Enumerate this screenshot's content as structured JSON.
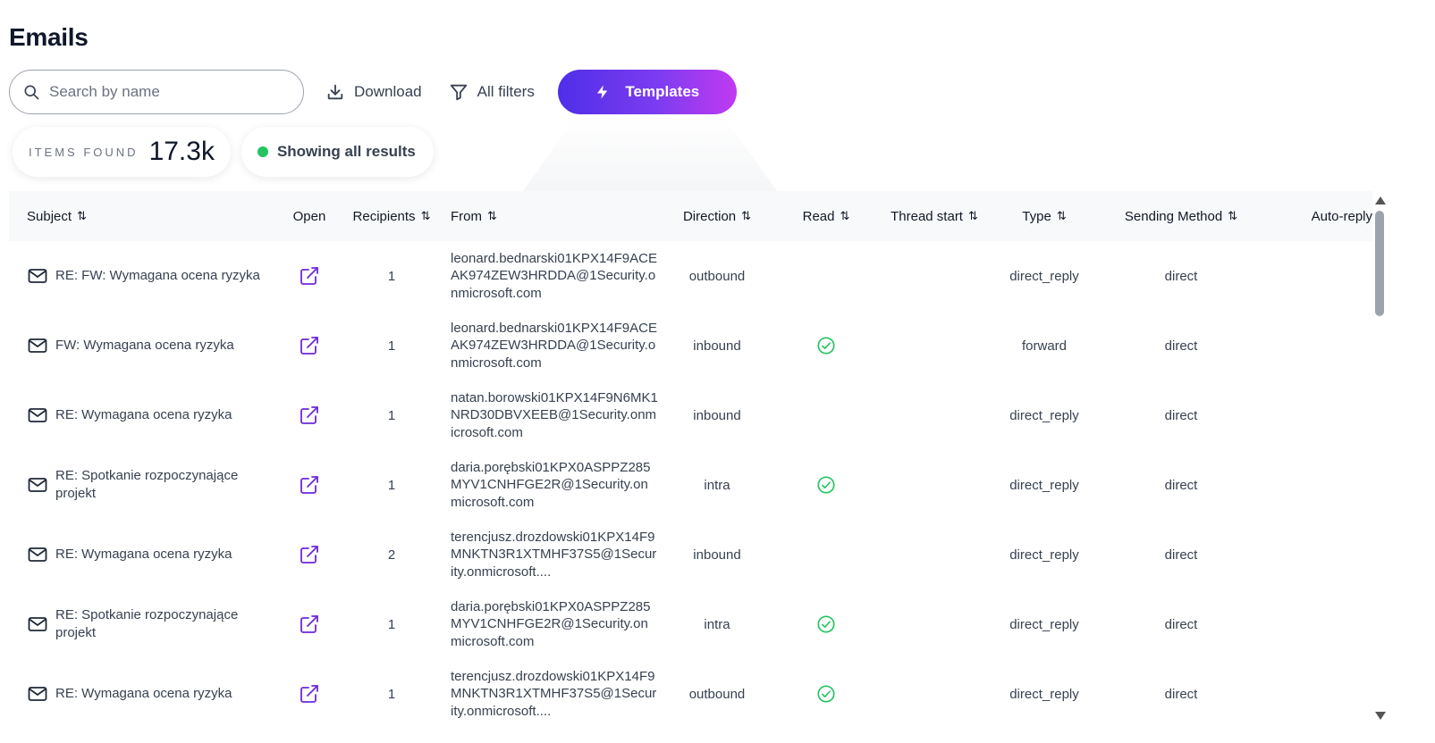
{
  "page": {
    "title": "Emails"
  },
  "toolbar": {
    "search_placeholder": "Search by name",
    "download_label": "Download",
    "filters_label": "All filters",
    "templates_label": "Templates"
  },
  "stats": {
    "items_label": "ITEMS FOUND",
    "items_value": "17.3k",
    "status_text": "Showing all results",
    "status_color": "#22c55e"
  },
  "table": {
    "columns": {
      "subject": "Subject",
      "open": "Open",
      "recipients": "Recipients",
      "from": "From",
      "direction": "Direction",
      "read": "Read",
      "thread_start": "Thread start",
      "type": "Type",
      "sending_method": "Sending Method",
      "auto_reply": "Auto-reply"
    },
    "rows": [
      {
        "subject": "RE: FW: Wymagana ocena ryzyka",
        "recipients": "1",
        "from": "leonard.bednarski01KPX14F9ACEAK974ZEW3HRDDA@1Security.onmicrosoft.com",
        "direction": "outbound",
        "read": false,
        "type": "direct_reply",
        "method": "direct"
      },
      {
        "subject": "FW: Wymagana ocena ryzyka",
        "recipients": "1",
        "from": "leonard.bednarski01KPX14F9ACEAK974ZEW3HRDDA@1Security.onmicrosoft.com",
        "direction": "inbound",
        "read": true,
        "type": "forward",
        "method": "direct"
      },
      {
        "subject": "RE: Wymagana ocena ryzyka",
        "recipients": "1",
        "from": "natan.borowski01KPX14F9N6MK1NRD30DBVXEEB@1Security.onmicrosoft.com",
        "direction": "inbound",
        "read": false,
        "type": "direct_reply",
        "method": "direct"
      },
      {
        "subject": "RE: Spotkanie rozpoczynające projekt",
        "recipients": "1",
        "from": "daria.porębski01KPX0ASPPZ285MYV1CNHFGE2R@1Security.onmicrosoft.com",
        "direction": "intra",
        "read": true,
        "type": "direct_reply",
        "method": "direct"
      },
      {
        "subject": "RE: Wymagana ocena ryzyka",
        "recipients": "2",
        "from": "terencjusz.drozdowski01KPX14F9MNKTN3R1XTMHF37S5@1Security.onmicrosoft....",
        "direction": "inbound",
        "read": false,
        "type": "direct_reply",
        "method": "direct"
      },
      {
        "subject": "RE: Spotkanie rozpoczynające projekt",
        "recipients": "1",
        "from": "daria.porębski01KPX0ASPPZ285MYV1CNHFGE2R@1Security.onmicrosoft.com",
        "direction": "intra",
        "read": true,
        "type": "direct_reply",
        "method": "direct"
      },
      {
        "subject": "RE: Wymagana ocena ryzyka",
        "recipients": "1",
        "from": "terencjusz.drozdowski01KPX14F9MNKTN3R1XTMHF37S5@1Security.onmicrosoft....",
        "direction": "outbound",
        "read": true,
        "type": "direct_reply",
        "method": "direct"
      }
    ]
  },
  "icons": {
    "search": "search-icon",
    "download": "download-icon",
    "filter": "filter-icon",
    "templates": "lightning-icon",
    "subject": "mail-icon",
    "open": "external-link-icon",
    "read": "check-circle-icon"
  },
  "colors": {
    "accent_start": "#4f2ee8",
    "accent_end": "#c13af0",
    "open_icon": "#6d28d9",
    "read_check": "#22c55e"
  }
}
